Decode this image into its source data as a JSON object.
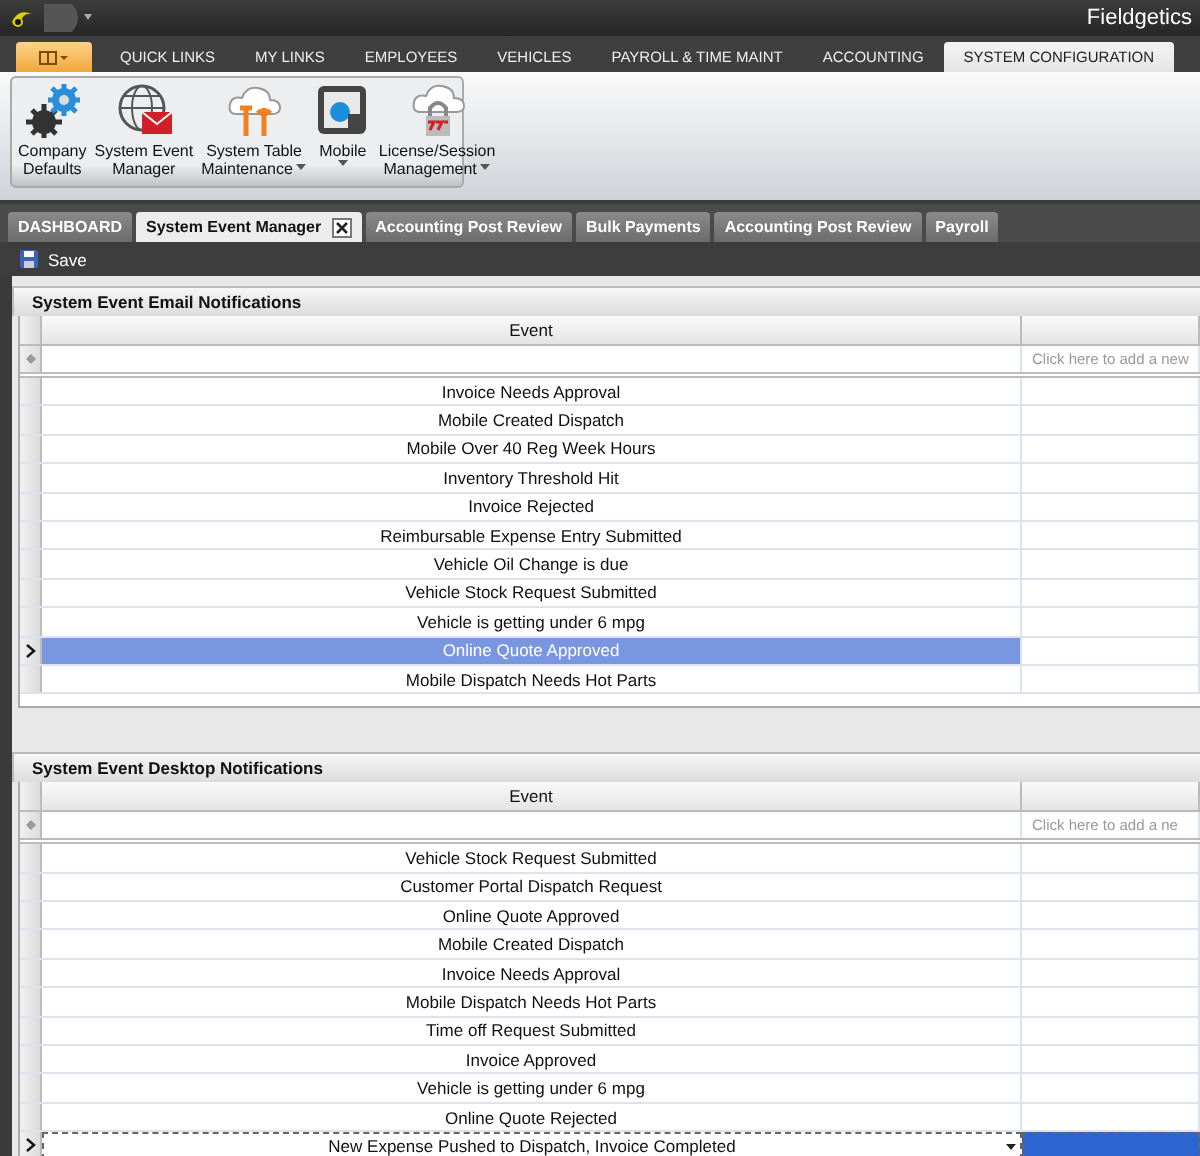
{
  "window": {
    "title": "Fieldgetics"
  },
  "menu_tabs": [
    {
      "label": "QUICK LINKS",
      "selected": false
    },
    {
      "label": "MY LINKS",
      "selected": false
    },
    {
      "label": "EMPLOYEES",
      "selected": false
    },
    {
      "label": "VEHICLES",
      "selected": false
    },
    {
      "label": "PAYROLL & TIME MAINT",
      "selected": false
    },
    {
      "label": "ACCOUNTING",
      "selected": false
    },
    {
      "label": "SYSTEM CONFIGURATION",
      "selected": true
    }
  ],
  "ribbon": {
    "buttons": [
      {
        "kind": "gears",
        "lines": [
          "Company",
          "Defaults"
        ],
        "dropdown": false
      },
      {
        "kind": "globe-mail",
        "lines": [
          "System Event",
          "Manager"
        ],
        "dropdown": false
      },
      {
        "kind": "cloud-tools",
        "lines": [
          "System Table",
          "Maintenance"
        ],
        "dropdown": true
      },
      {
        "kind": "mobile",
        "lines": [
          "Mobile"
        ],
        "dropdown": true
      },
      {
        "kind": "cloud-lock",
        "lines": [
          "License/Session",
          "Management"
        ],
        "dropdown": true
      }
    ]
  },
  "doc_tabs": [
    {
      "label": "DASHBOARD",
      "selected": false,
      "closable": false
    },
    {
      "label": "System Event Manager",
      "selected": true,
      "closable": true
    },
    {
      "label": "Accounting Post Review",
      "selected": false,
      "closable": false
    },
    {
      "label": "Bulk Payments",
      "selected": false,
      "closable": false
    },
    {
      "label": "Accounting Post Review",
      "selected": false,
      "closable": false
    },
    {
      "label": "Payroll",
      "selected": false,
      "closable": false
    }
  ],
  "toolbar": {
    "buttons": [
      {
        "label": "Save"
      }
    ]
  },
  "grids": [
    {
      "title": "System Event Email Notifications",
      "columns": [
        "Event"
      ],
      "new_row_prompt": "Click here to add a new",
      "rows": [
        {
          "event": "Invoice Needs Approval",
          "selected": false,
          "editing": false
        },
        {
          "event": "Mobile Created Dispatch",
          "selected": false,
          "editing": false
        },
        {
          "event": "Mobile Over 40 Reg Week Hours",
          "selected": false,
          "editing": false
        },
        {
          "event": "Inventory Threshold Hit",
          "selected": false,
          "editing": false
        },
        {
          "event": "Invoice Rejected",
          "selected": false,
          "editing": false
        },
        {
          "event": "Reimbursable Expense Entry Submitted",
          "selected": false,
          "editing": false
        },
        {
          "event": "Vehicle Oil Change is due",
          "selected": false,
          "editing": false
        },
        {
          "event": "Vehicle Stock Request Submitted",
          "selected": false,
          "editing": false
        },
        {
          "event": "Vehicle is getting under 6 mpg",
          "selected": false,
          "editing": false
        },
        {
          "event": "Online Quote Approved",
          "selected": true,
          "editing": false
        },
        {
          "event": "Mobile Dispatch Needs Hot Parts",
          "selected": false,
          "editing": false
        }
      ]
    },
    {
      "title": "System Event Desktop Notifications",
      "columns": [
        "Event"
      ],
      "new_row_prompt": "Click here to add a ne",
      "rows": [
        {
          "event": "Vehicle Stock Request Submitted",
          "selected": false,
          "editing": false
        },
        {
          "event": "Customer Portal Dispatch Request",
          "selected": false,
          "editing": false
        },
        {
          "event": "Online Quote Approved",
          "selected": false,
          "editing": false
        },
        {
          "event": "Mobile Created Dispatch",
          "selected": false,
          "editing": false
        },
        {
          "event": "Invoice Needs Approval",
          "selected": false,
          "editing": false
        },
        {
          "event": "Mobile Dispatch Needs Hot Parts",
          "selected": false,
          "editing": false
        },
        {
          "event": "Time off Request Submitted",
          "selected": false,
          "editing": false
        },
        {
          "event": "Invoice Approved",
          "selected": false,
          "editing": false
        },
        {
          "event": "Vehicle is getting under 6 mpg",
          "selected": false,
          "editing": false
        },
        {
          "event": "Online Quote Rejected",
          "selected": false,
          "editing": false
        },
        {
          "event": "New Expense Pushed to Dispatch, Invoice Completed",
          "selected": true,
          "editing": true
        }
      ]
    }
  ]
}
